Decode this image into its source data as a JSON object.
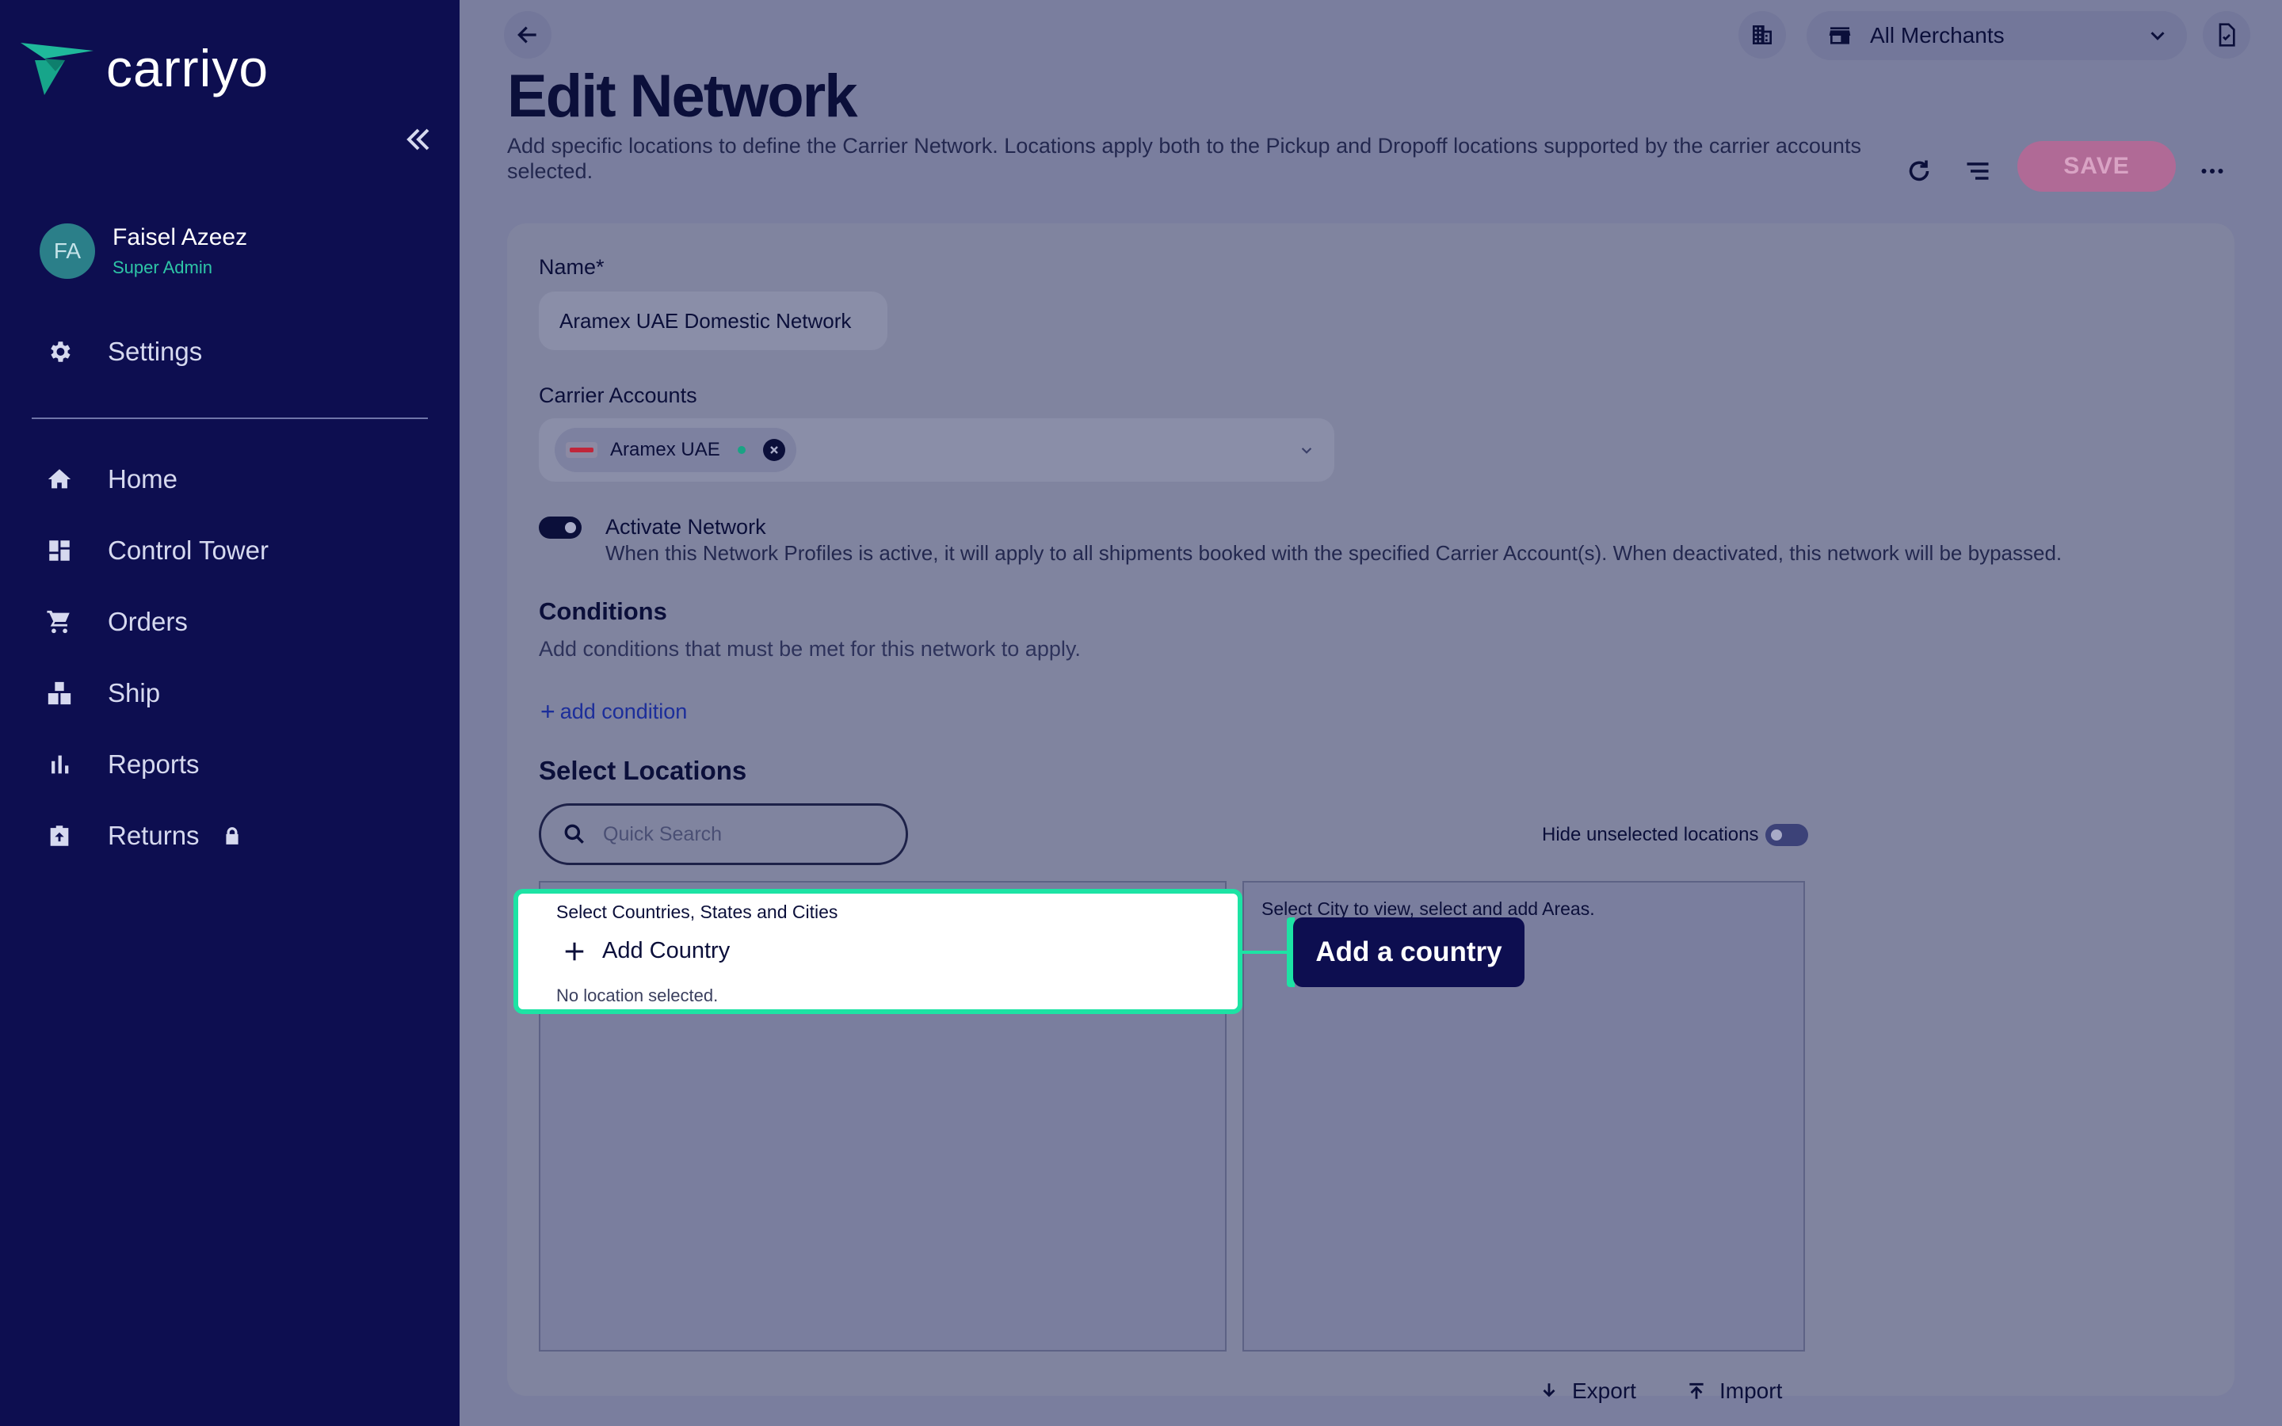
{
  "app": {
    "brand": "carriyo"
  },
  "user": {
    "initials": "FA",
    "name": "Faisel Azeez",
    "role": "Super Admin"
  },
  "sidebar": {
    "settings_label": "Settings",
    "items": [
      {
        "label": "Home",
        "icon": "home-icon"
      },
      {
        "label": "Control Tower",
        "icon": "dashboard-icon"
      },
      {
        "label": "Orders",
        "icon": "cart-icon"
      },
      {
        "label": "Ship",
        "icon": "boxes-icon"
      },
      {
        "label": "Reports",
        "icon": "bar-chart-icon"
      },
      {
        "label": "Returns",
        "icon": "return-box-icon",
        "locked": true
      }
    ]
  },
  "header": {
    "merchant_select": "All Merchants",
    "title": "Edit Network",
    "description": "Add specific locations to define the Carrier Network. Locations apply both to the Pickup and Dropoff locations supported by the carrier accounts selected.",
    "save_label": "SAVE"
  },
  "form": {
    "name_label": "Name*",
    "name_value": "Aramex UAE Domestic Network",
    "carrier_label": "Carrier Accounts",
    "carrier_chip": "Aramex UAE",
    "activate_label": "Activate Network",
    "activate_desc": "When this Network Profiles is active, it will apply to all shipments booked with the specified Carrier Account(s). When deactivated, this network will be bypassed.",
    "activate_on": true,
    "conditions_title": "Conditions",
    "conditions_desc": "Add conditions that must be met for this network to apply.",
    "add_condition": "add condition",
    "locations_title": "Select Locations",
    "search_placeholder": "Quick Search",
    "hide_unselected_label": "Hide unselected locations",
    "left_panel_title": "Select Countries, States and Cities",
    "add_country": "Add Country",
    "no_location": "No location selected.",
    "right_panel_title": "Select City to view, select and add Areas.",
    "export_label": "Export",
    "import_label": "Import"
  },
  "tooltip": {
    "text": "Add a country"
  },
  "colors": {
    "sidebar": "#0d0e50",
    "accent": "#1de3a4",
    "save": "#b06a96"
  }
}
